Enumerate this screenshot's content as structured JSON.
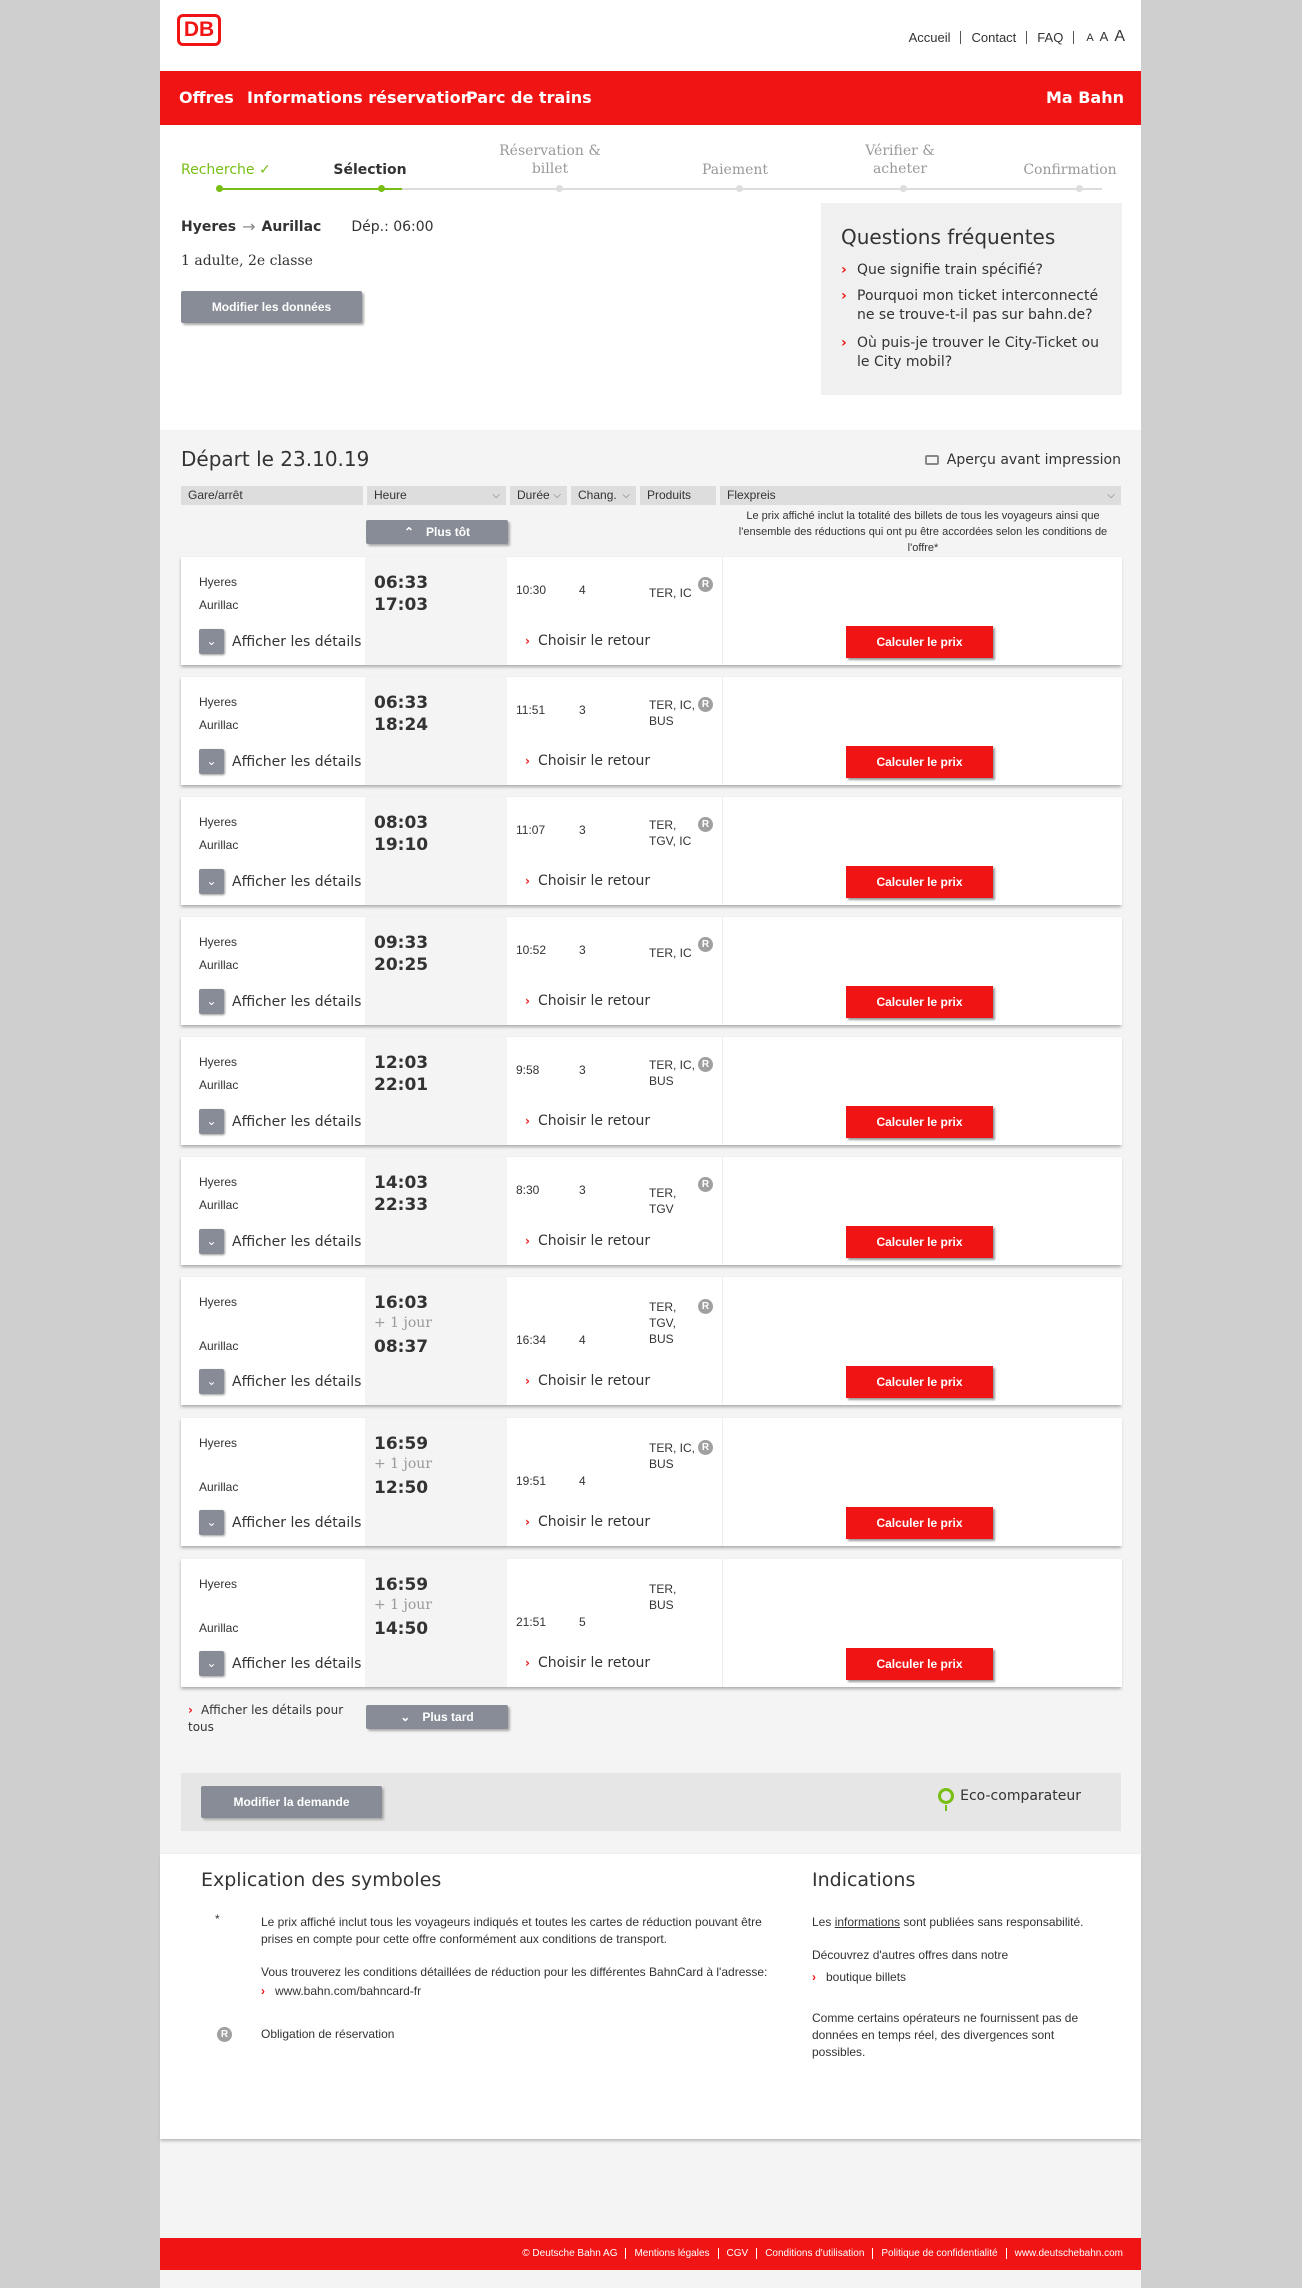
{
  "header": {
    "logo": "DB",
    "links": [
      "Accueil",
      "Contact",
      "FAQ"
    ],
    "font_sizes": [
      "A",
      "A",
      "A"
    ]
  },
  "nav": {
    "items": [
      "Offres",
      "Informations réservation",
      "Parc de trains"
    ],
    "right": "Ma Bahn"
  },
  "wizard": {
    "steps": [
      "Recherche",
      "Sélection",
      "Réservation & billet",
      "Paiement",
      "Vérifier & acheter",
      "Confirmation"
    ],
    "active": 1,
    "done": 0
  },
  "search": {
    "from": "Hyeres",
    "to": "Aurillac",
    "dep": "Dép.: 06:00",
    "passengers": "1 adulte, 2e classe",
    "modify_button": "Modifier les données"
  },
  "faq": {
    "title": "Questions fréquentes",
    "items": [
      "Que signifie train spécifié?",
      "Pourquoi mon ticket interconnecté ne se trouve-t-il pas sur bahn.de?",
      "Où puis-je trouver le City-Ticket ou le City mobil?"
    ]
  },
  "results": {
    "title": "Départ le 23.10.19",
    "print": "Aperçu avant impression",
    "columns": {
      "station": "Gare/arrêt",
      "time": "Heure",
      "duration": "Durée",
      "changes": "Chang.",
      "products": "Produits",
      "price": "Flexpreis"
    },
    "price_note": "Le prix affiché inclut la totalité des billets de tous les voyageurs ainsi que l'ensemble des réductions qui ont pu être accordées selon les conditions de l'offre*",
    "earlier": "Plus tôt",
    "later": "Plus tard",
    "show_all": "Afficher les détails pour tous",
    "details_label": "Afficher les détails",
    "return_label": "Choisir le retour",
    "calc_label": "Calculer le prix",
    "badge": "R",
    "rows": [
      {
        "from": "Hyeres",
        "to": "Aurillac",
        "dep": "06:33",
        "arr": "17:03",
        "plus": "",
        "dur": "10:30",
        "chg": "4",
        "prod": "TER, IC",
        "r": true
      },
      {
        "from": "Hyeres",
        "to": "Aurillac",
        "dep": "06:33",
        "arr": "18:24",
        "plus": "",
        "dur": "11:51",
        "chg": "3",
        "prod": "TER, IC, BUS",
        "r": true
      },
      {
        "from": "Hyeres",
        "to": "Aurillac",
        "dep": "08:03",
        "arr": "19:10",
        "plus": "",
        "dur": "11:07",
        "chg": "3",
        "prod": "TER, TGV, IC",
        "r": true
      },
      {
        "from": "Hyeres",
        "to": "Aurillac",
        "dep": "09:33",
        "arr": "20:25",
        "plus": "",
        "dur": "10:52",
        "chg": "3",
        "prod": "TER, IC",
        "r": true
      },
      {
        "from": "Hyeres",
        "to": "Aurillac",
        "dep": "12:03",
        "arr": "22:01",
        "plus": "",
        "dur": "9:58",
        "chg": "3",
        "prod": "TER, IC, BUS",
        "r": true
      },
      {
        "from": "Hyeres",
        "to": "Aurillac",
        "dep": "14:03",
        "arr": "22:33",
        "plus": "",
        "dur": "8:30",
        "chg": "3",
        "prod": "TER, TGV",
        "r": true
      },
      {
        "from": "Hyeres",
        "to": "Aurillac",
        "dep": "16:03",
        "arr": "08:37",
        "plus": "+ 1 jour",
        "dur": "16:34",
        "chg": "4",
        "prod": "TER, TGV, BUS",
        "r": true
      },
      {
        "from": "Hyeres",
        "to": "Aurillac",
        "dep": "16:59",
        "arr": "12:50",
        "plus": "+ 1 jour",
        "dur": "19:51",
        "chg": "4",
        "prod": "TER, IC, BUS",
        "r": true
      },
      {
        "from": "Hyeres",
        "to": "Aurillac",
        "dep": "16:59",
        "arr": "14:50",
        "plus": "+ 1 jour",
        "dur": "21:51",
        "chg": "5",
        "prod": "TER, BUS",
        "r": false
      }
    ]
  },
  "modify_request": "Modifier la demande",
  "eco": "Eco-comparateur",
  "symbols": {
    "title": "Explication des symboles",
    "star": "*",
    "star_text": "Le prix affiché inclut tous les voyageurs indiqués et toutes les cartes de réduction pouvant être prises en compte pour cette offre conformément aux conditions de transport.",
    "bahncard_text": "Vous trouverez les conditions détaillées de réduction pour les différentes BahnCard à l'adresse:",
    "bahncard_link": "www.bahn.com/bahncard-fr",
    "r_badge": "R",
    "r_text": "Obligation de réservation"
  },
  "indications": {
    "title": "Indications",
    "p1_pre": "Les ",
    "p1_link": "informations",
    "p1_post": " sont publiées sans responsabilité.",
    "p2": "Découvrez d'autres offres dans notre",
    "p2_link": "boutique billets",
    "p3": "Comme certains opérateurs ne fournissent pas de données en temps réel, des divergences sont possibles."
  },
  "footer": {
    "links": [
      "© Deutsche Bahn AG",
      "Mentions légales",
      "CGV",
      "Conditions d'utilisation",
      "Politique de confidentialité",
      "www.deutschebahn.com"
    ]
  },
  "colors": {
    "brand_red": "#f01414",
    "done_green": "#78be14",
    "button_grey": "#878c96"
  }
}
